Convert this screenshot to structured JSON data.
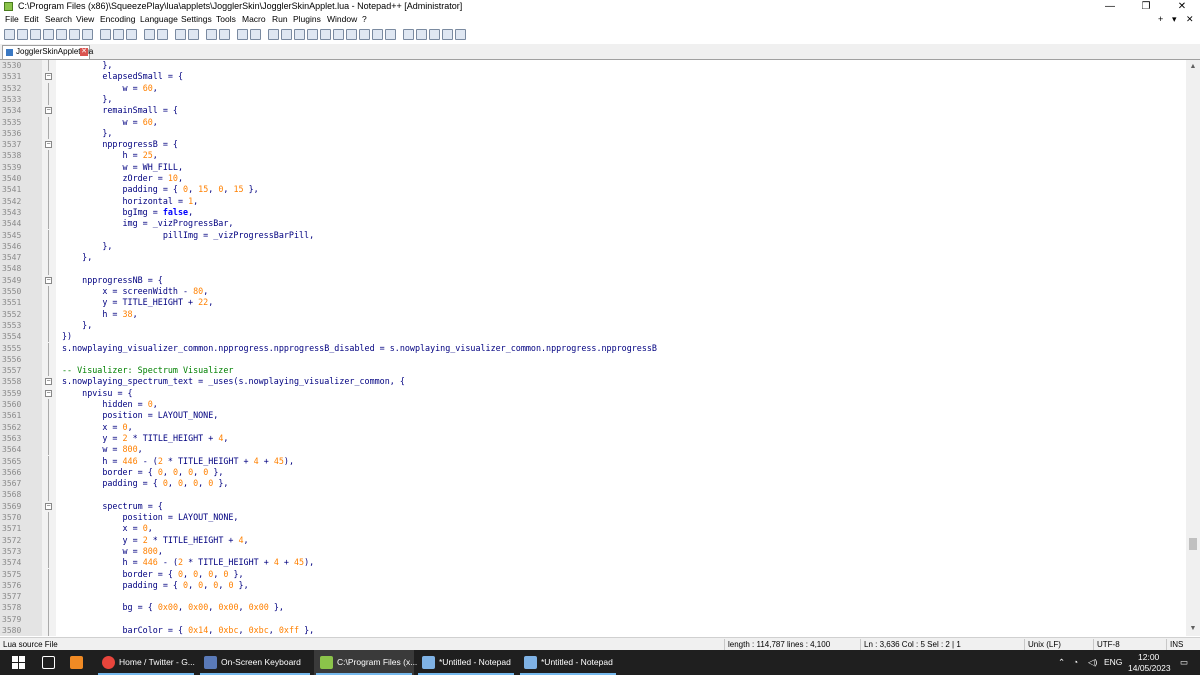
{
  "window": {
    "title": "C:\\Program Files (x86)\\SqueezePlay\\lua\\applets\\JogglerSkin\\JogglerSkinApplet.lua - Notepad++ [Administrator]",
    "minimize_glyph": "—",
    "restore_glyph": "❐",
    "close_glyph": "✕"
  },
  "menu": {
    "items": [
      "File",
      "Edit",
      "Search",
      "View",
      "Encoding",
      "Language",
      "Settings",
      "Tools",
      "Macro",
      "Run",
      "Plugins",
      "Window",
      "?"
    ],
    "right": [
      "+",
      "▾",
      "✕"
    ]
  },
  "tab": {
    "label": "JogglerSkinApplet.lua",
    "close_glyph": "✕"
  },
  "editor": {
    "lines": [
      {
        "n": "3530",
        "code": "        },"
      },
      {
        "n": "3531",
        "code": "        elapsedSmall = {",
        "fold": "minus"
      },
      {
        "n": "3532",
        "code": "            w = 60,"
      },
      {
        "n": "3533",
        "code": "        },"
      },
      {
        "n": "3534",
        "code": "        remainSmall = {",
        "fold": "minus"
      },
      {
        "n": "3535",
        "code": "            w = 60,"
      },
      {
        "n": "3536",
        "code": "        },"
      },
      {
        "n": "3537",
        "code": "        npprogressB = {",
        "fold": "minus"
      },
      {
        "n": "3538",
        "code": "            h = 25,"
      },
      {
        "n": "3539",
        "code": "            w = WH_FILL,"
      },
      {
        "n": "3540",
        "code": "            zOrder = 10,"
      },
      {
        "n": "3541",
        "code": "            padding = { 0, 15, 0, 15 },"
      },
      {
        "n": "3542",
        "code": "            horizontal = 1,"
      },
      {
        "n": "3543",
        "code": "            bgImg = false,"
      },
      {
        "n": "3544",
        "code": "            img = _vizProgressBar,"
      },
      {
        "n": "3545",
        "code": "                    pillImg = _vizProgressBarPill,"
      },
      {
        "n": "3546",
        "code": "        },"
      },
      {
        "n": "3547",
        "code": "    },"
      },
      {
        "n": "3548",
        "code": ""
      },
      {
        "n": "3549",
        "code": "    npprogressNB = {",
        "fold": "minus"
      },
      {
        "n": "3550",
        "code": "        x = screenWidth - 80,"
      },
      {
        "n": "3551",
        "code": "        y = TITLE_HEIGHT + 22,"
      },
      {
        "n": "3552",
        "code": "        h = 38,"
      },
      {
        "n": "3553",
        "code": "    },"
      },
      {
        "n": "3554",
        "code": "})"
      },
      {
        "n": "3555",
        "code": "s.nowplaying_visualizer_common.npprogress.npprogressB_disabled = s.nowplaying_visualizer_common.npprogress.npprogressB"
      },
      {
        "n": "3556",
        "code": ""
      },
      {
        "n": "3557",
        "code": "-- Visualizer: Spectrum Visualizer",
        "kind": "comment"
      },
      {
        "n": "3558",
        "code": "s.nowplaying_spectrum_text = _uses(s.nowplaying_visualizer_common, {",
        "fold": "minus"
      },
      {
        "n": "3559",
        "code": "    npvisu = {",
        "fold": "minus"
      },
      {
        "n": "3560",
        "code": "        hidden = 0,"
      },
      {
        "n": "3561",
        "code": "        position = LAYOUT_NONE,"
      },
      {
        "n": "3562",
        "code": "        x = 0,"
      },
      {
        "n": "3563",
        "code": "        y = 2 * TITLE_HEIGHT + 4,"
      },
      {
        "n": "3564",
        "code": "        w = 800,"
      },
      {
        "n": "3565",
        "code": "        h = 446 - (2 * TITLE_HEIGHT + 4 + 45),"
      },
      {
        "n": "3566",
        "code": "        border = { 0, 0, 0, 0 },"
      },
      {
        "n": "3567",
        "code": "        padding = { 0, 0, 0, 0 },"
      },
      {
        "n": "3568",
        "code": ""
      },
      {
        "n": "3569",
        "code": "        spectrum = {",
        "fold": "minus"
      },
      {
        "n": "3570",
        "code": "            position = LAYOUT_NONE,"
      },
      {
        "n": "3571",
        "code": "            x = 0,"
      },
      {
        "n": "3572",
        "code": "            y = 2 * TITLE_HEIGHT + 4,"
      },
      {
        "n": "3573",
        "code": "            w = 800,"
      },
      {
        "n": "3574",
        "code": "            h = 446 - (2 * TITLE_HEIGHT + 4 + 45),"
      },
      {
        "n": "3575",
        "code": "            border = { 0, 0, 0, 0 },"
      },
      {
        "n": "3576",
        "code": "            padding = { 0, 0, 0, 0 },"
      },
      {
        "n": "3577",
        "code": ""
      },
      {
        "n": "3578",
        "code": "            bg = { 0x00, 0x00, 0x00, 0x00 },"
      },
      {
        "n": "3579",
        "code": ""
      },
      {
        "n": "3580",
        "code": "            barColor = { 0x14, 0xbc, 0xbc, 0xff },"
      }
    ]
  },
  "status": {
    "file_type": "Lua source File",
    "length": "length : 114,787    lines : 4,100",
    "position": "Ln : 3,636    Col : 5    Sel : 2 | 1",
    "eol": "Unix (LF)",
    "encoding": "UTF-8",
    "mode": "INS"
  },
  "taskbar": {
    "items": [
      {
        "label": "Home / Twitter - G...",
        "icon": "chrome-icon",
        "color": "#e8453c"
      },
      {
        "label": "On-Screen Keyboard",
        "icon": "keyboard-icon",
        "color": "#5a7ab8"
      },
      {
        "label": "C:\\Program Files (x...",
        "icon": "notepadpp-icon",
        "color": "#8bc34a",
        "active": true
      },
      {
        "label": "*Untitled - Notepad",
        "icon": "notepad-icon",
        "color": "#7fb2e5"
      },
      {
        "label": "*Untitled - Notepad",
        "icon": "notepad-icon",
        "color": "#7fb2e5"
      }
    ],
    "lang": "ENG",
    "time": "12:00",
    "date": "14/05/2023"
  }
}
